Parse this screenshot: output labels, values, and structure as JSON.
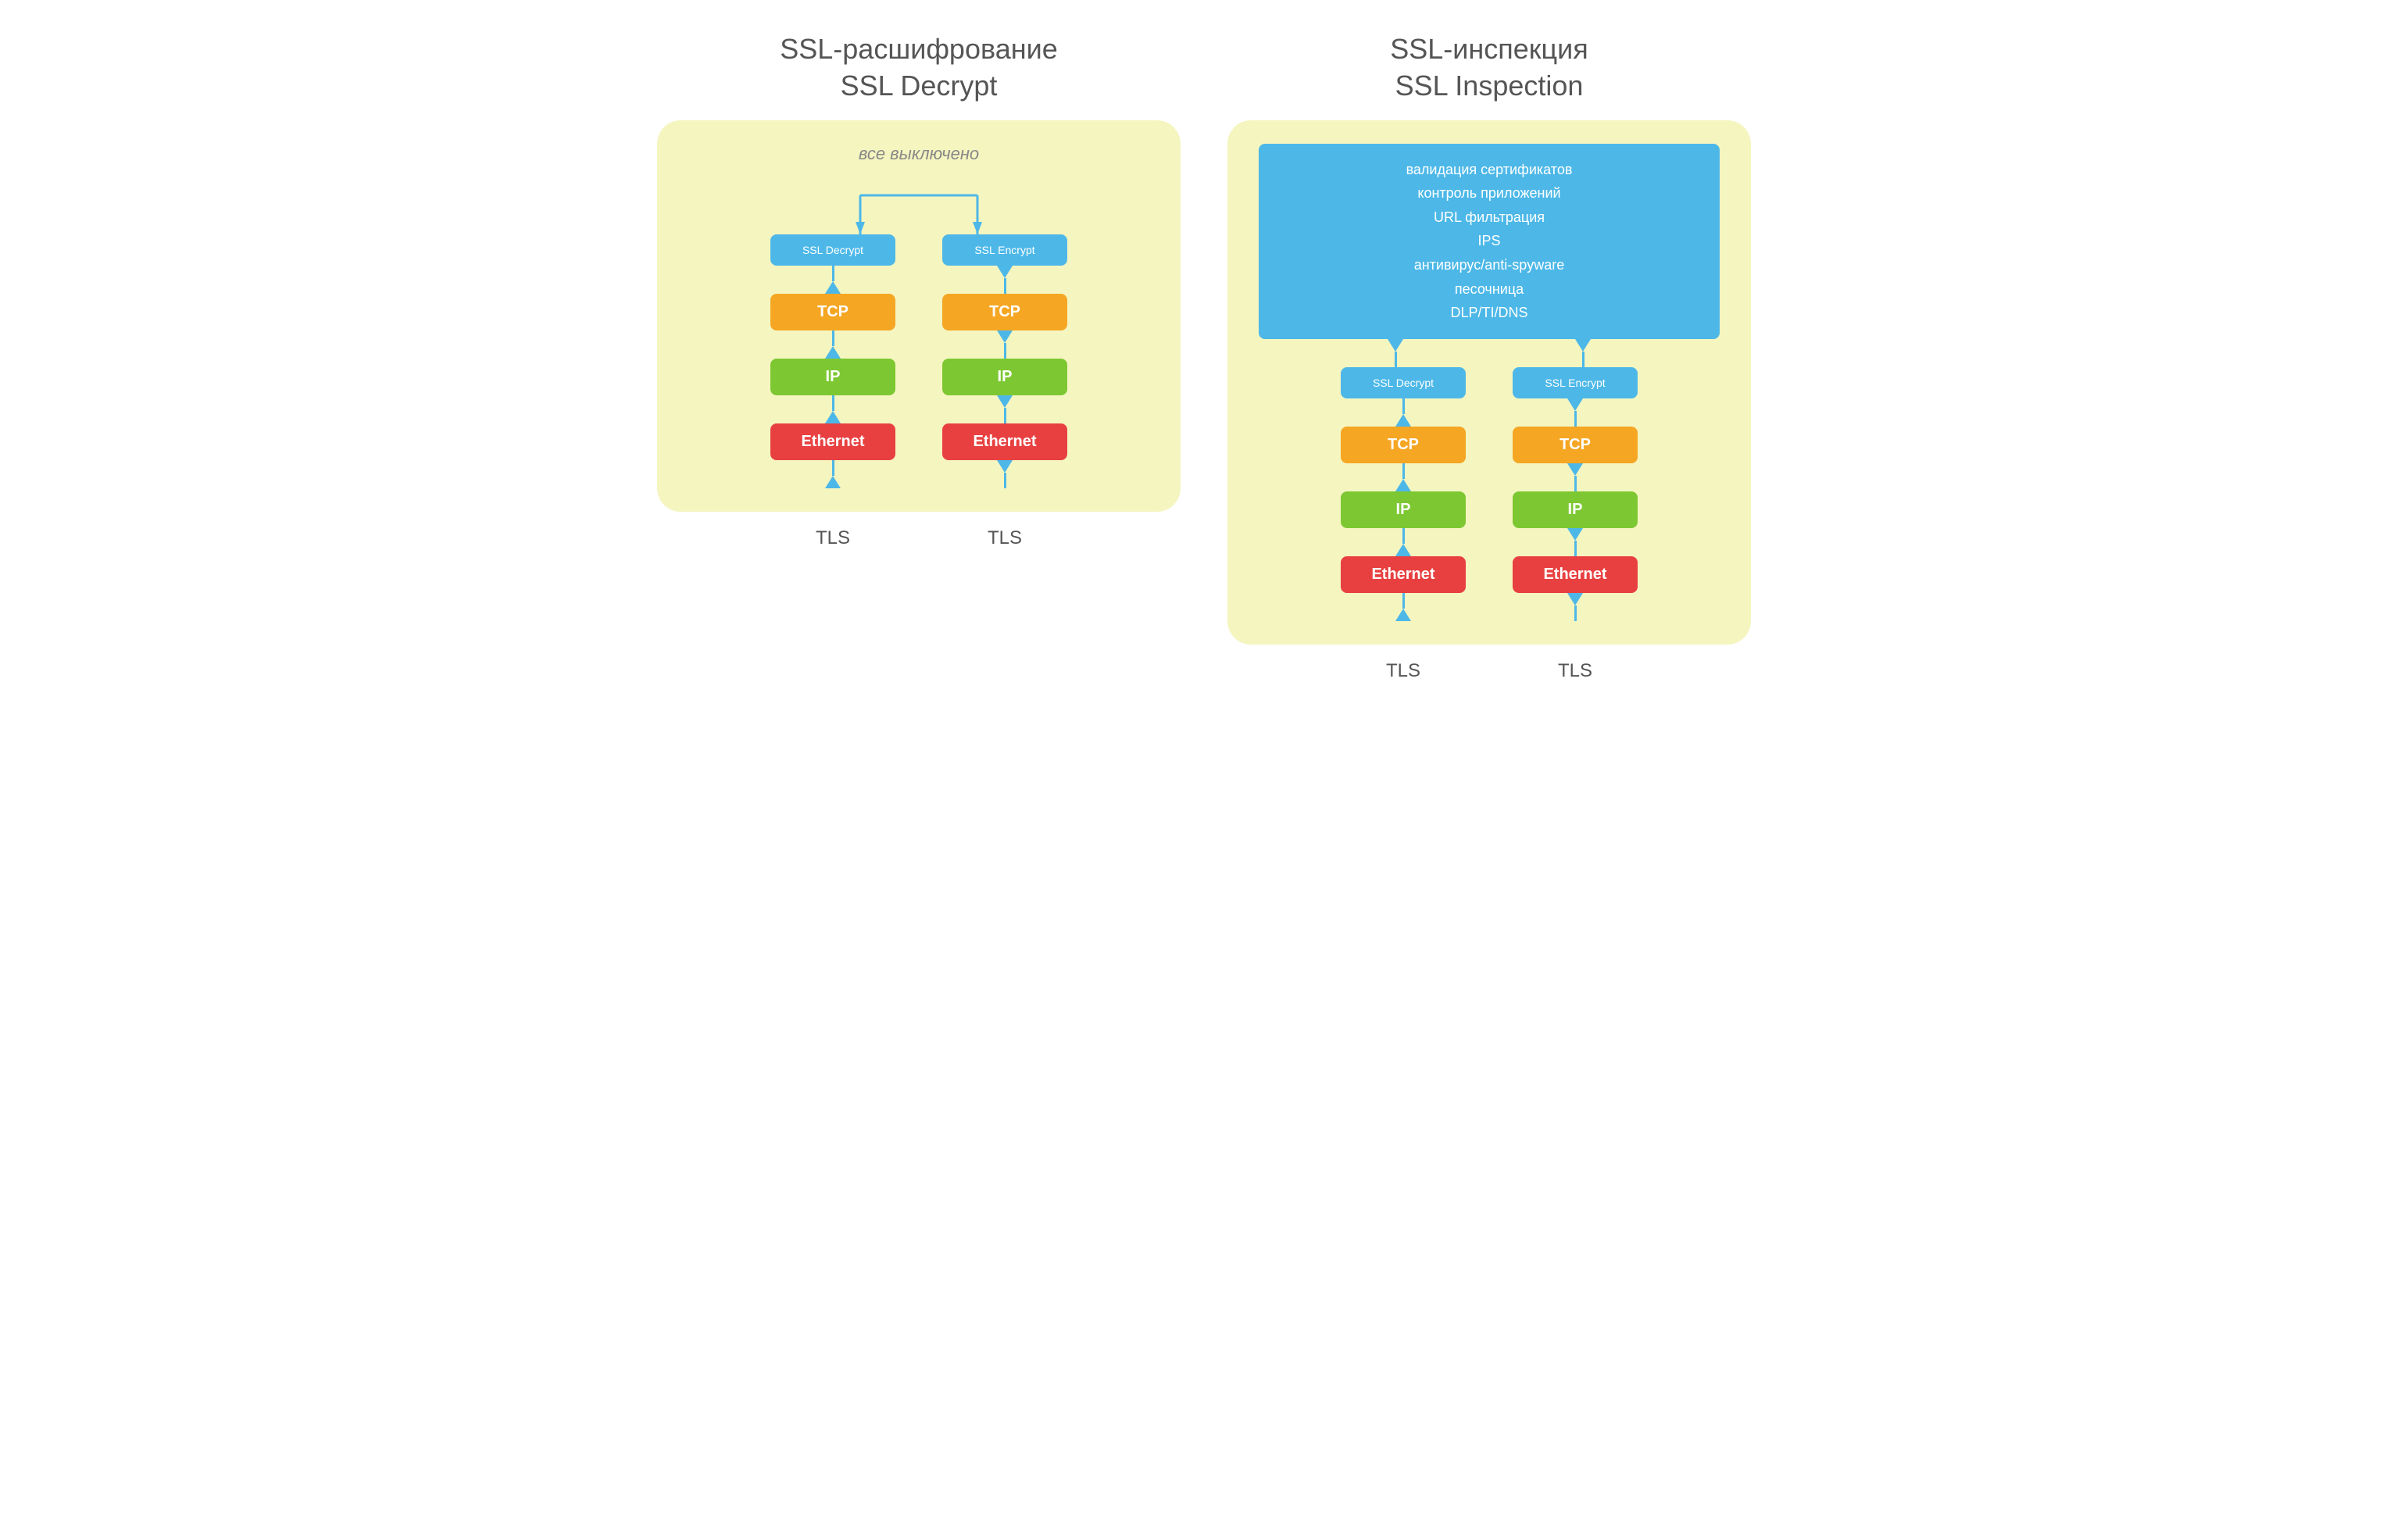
{
  "left": {
    "title_ru": "SSL-расшифрование",
    "title_en": "SSL Decrypt",
    "disabled_label": "все выключено",
    "col1": {
      "ssl": "SSL Decrypt",
      "tcp": "TCP",
      "ip": "IP",
      "eth": "Ethernet",
      "tls": "TLS"
    },
    "col2": {
      "ssl": "SSL Encrypt",
      "tcp": "TCP",
      "ip": "IP",
      "eth": "Ethernet",
      "tls": "TLS"
    }
  },
  "right": {
    "title_ru": "SSL-инспекция",
    "title_en": "SSL Inspection",
    "inspection_lines": [
      "валидация сертификатов",
      "контроль приложений",
      "URL фильтрация",
      "IPS",
      "антивирус/anti-spyware",
      "песочница",
      "DLP/TI/DNS"
    ],
    "col1": {
      "ssl": "SSL Decrypt",
      "tcp": "TCP",
      "ip": "IP",
      "eth": "Ethernet",
      "tls": "TLS"
    },
    "col2": {
      "ssl": "SSL Encrypt",
      "tcp": "TCP",
      "ip": "IP",
      "eth": "Ethernet",
      "tls": "TLS"
    }
  }
}
